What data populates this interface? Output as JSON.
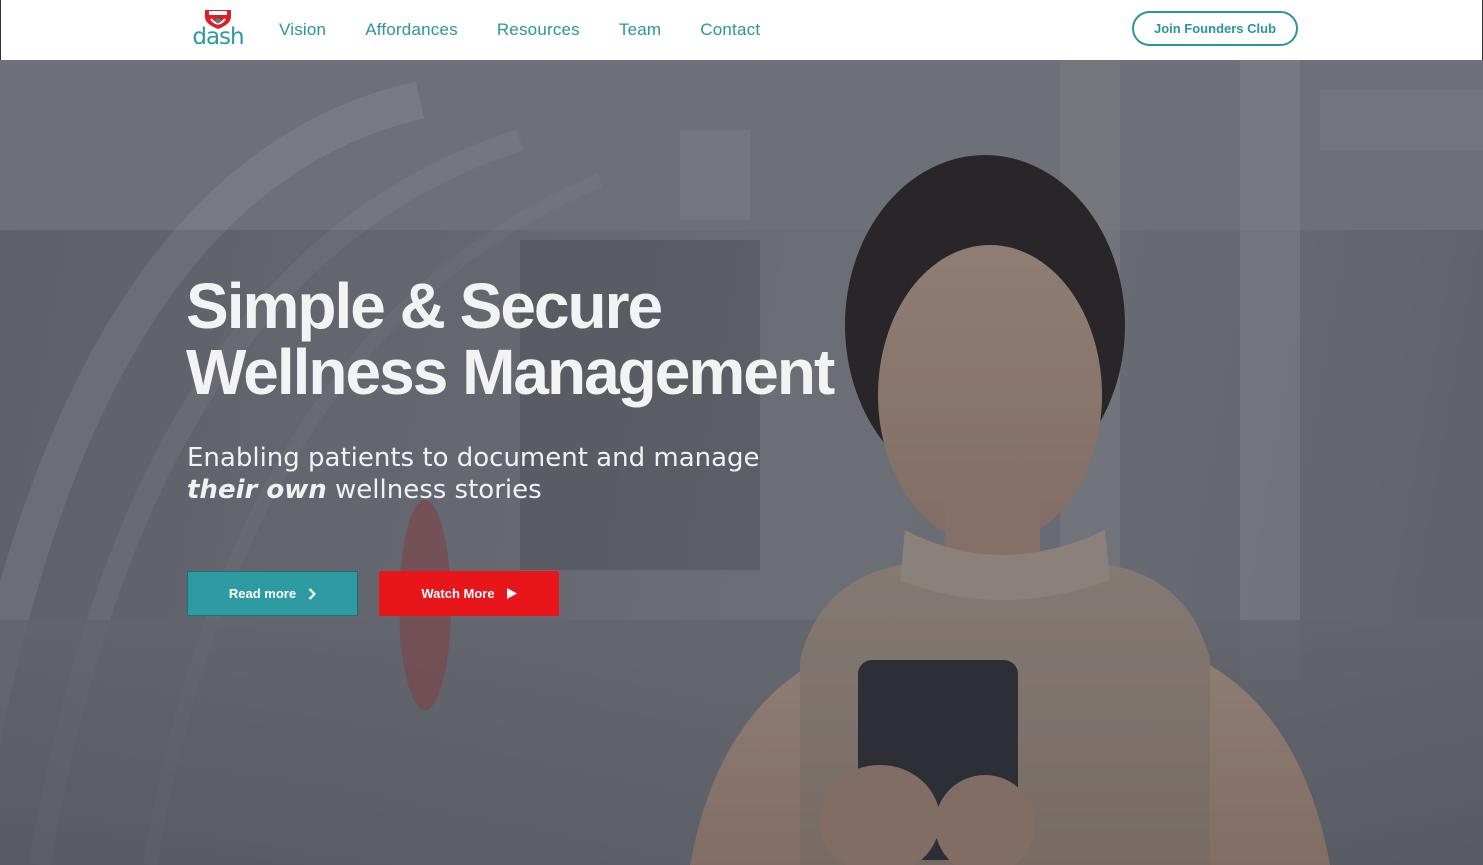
{
  "header": {
    "logo_text": "dash",
    "nav": [
      {
        "label": "Vision"
      },
      {
        "label": "Affordances"
      },
      {
        "label": "Resources"
      },
      {
        "label": "Team"
      },
      {
        "label": "Contact"
      }
    ],
    "cta_label": "Join Founders Club"
  },
  "hero": {
    "title_line1": "Simple & Secure",
    "title_line2": "Wellness Management",
    "subtitle_line1": "Enabling patients to document and manage",
    "subtitle_emphasis": "their own",
    "subtitle_line2_rest": "wellness stories",
    "read_more_label": "Read more",
    "read_more_icon": "chevron-right-icon",
    "watch_more_label": "Watch More",
    "watch_more_icon": "play-icon"
  },
  "colors": {
    "brand_teal": "#2b959c",
    "brand_red": "#e8161a",
    "hero_text": "#f3f3f4"
  }
}
